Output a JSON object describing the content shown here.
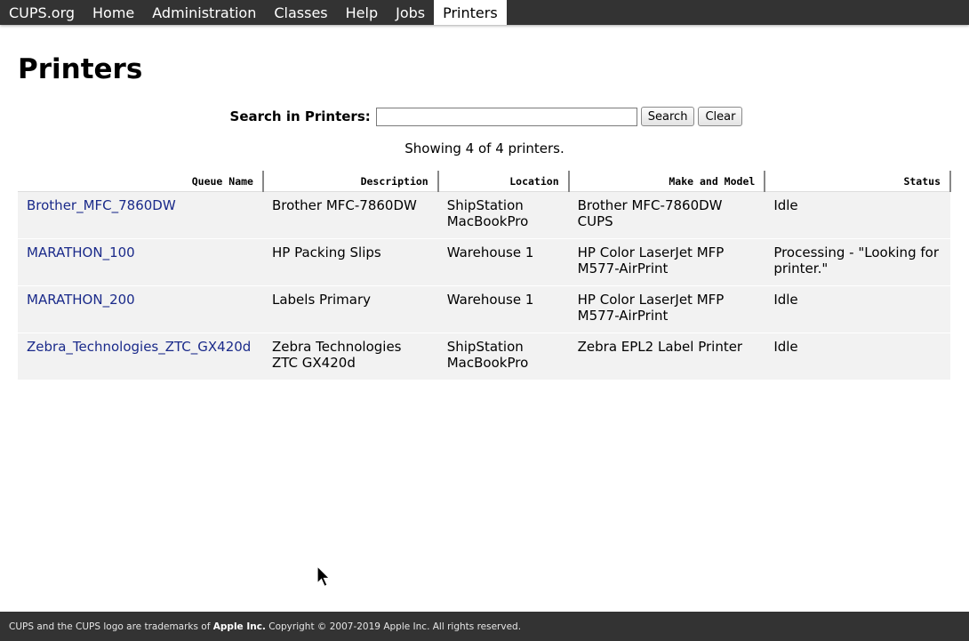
{
  "nav": {
    "items": [
      {
        "label": "CUPS.org"
      },
      {
        "label": "Home"
      },
      {
        "label": "Administration"
      },
      {
        "label": "Classes"
      },
      {
        "label": "Help"
      },
      {
        "label": "Jobs"
      },
      {
        "label": "Printers",
        "active": true
      }
    ]
  },
  "page": {
    "title": "Printers"
  },
  "search": {
    "label": "Search in Printers:",
    "value": "",
    "search_button": "Search",
    "clear_button": "Clear"
  },
  "summary": "Showing 4 of 4 printers.",
  "table": {
    "columns": [
      "Queue Name",
      "Description",
      "Location",
      "Make and Model",
      "Status"
    ],
    "rows": [
      {
        "queue": "Brother_MFC_7860DW",
        "description": "Brother MFC-7860DW",
        "location": "ShipStation MacBookPro",
        "model": "Brother MFC-7860DW CUPS",
        "status": "Idle"
      },
      {
        "queue": "MARATHON_100",
        "description": "HP Packing Slips",
        "location": "Warehouse 1",
        "model": "HP Color LaserJet MFP M577-AirPrint",
        "status": "Processing - \"Looking for printer.\""
      },
      {
        "queue": "MARATHON_200",
        "description": "Labels Primary",
        "location": "Warehouse 1",
        "model": "HP Color LaserJet MFP M577-AirPrint",
        "status": "Idle"
      },
      {
        "queue": "Zebra_Technologies_ZTC_GX420d",
        "description": "Zebra Technologies ZTC GX420d",
        "location": "ShipStation MacBookPro",
        "model": "Zebra EPL2 Label Printer",
        "status": "Idle"
      }
    ]
  },
  "footer": {
    "prefix": "CUPS and the CUPS logo are trademarks of ",
    "company": "Apple Inc.",
    "suffix": " Copyright © 2007-2019 Apple Inc. All rights reserved."
  },
  "colors": {
    "nav_bg": "#333333",
    "link": "#1a2a8a",
    "row_bg": "#f2f2f2"
  }
}
